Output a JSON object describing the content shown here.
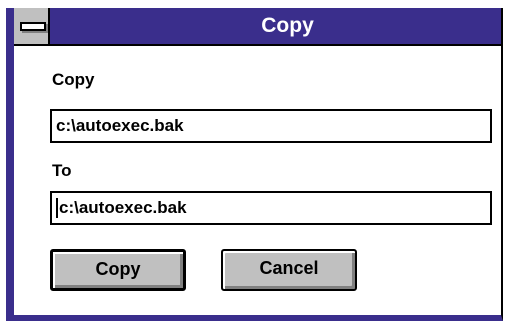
{
  "window": {
    "title": "Copy",
    "colors": {
      "titlebar": "#3a2e8c",
      "button_face": "#c0c0c0"
    },
    "system_menu_icon": "system-menu-icon"
  },
  "form": {
    "from_label": "Copy",
    "from_value": "c:\\autoexec.bak",
    "to_label": "To",
    "to_value": "c:\\autoexec.bak"
  },
  "buttons": {
    "ok_label": "Copy",
    "cancel_label": "Cancel"
  }
}
